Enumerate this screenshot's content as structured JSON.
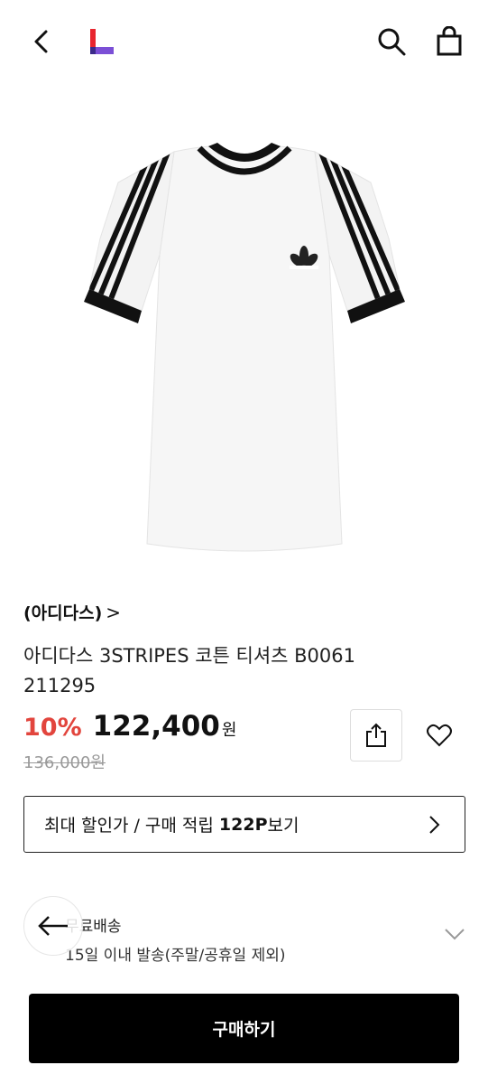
{
  "header": {
    "back_icon": "chevron-left-icon",
    "logo_icon": "lotte-l-logo",
    "search_icon": "search-icon",
    "bag_icon": "shopping-bag-icon"
  },
  "product": {
    "brand": "(아디다스)",
    "brand_chevron": ">",
    "name": "아디다스 3STRIPES 코튼 티셔츠 B0061 211295",
    "discount_rate": "10%",
    "price": "122,400",
    "currency": "원",
    "original_price": "136,000원",
    "image_logo_text": "adidas"
  },
  "actions": {
    "share_icon": "share-icon",
    "wish_icon": "heart-icon"
  },
  "discount_box": {
    "prefix": "최대 할인가 / 구매 적립 ",
    "points": "122P",
    "suffix": "보기"
  },
  "shipping": {
    "title": "무료배송",
    "description": "15일 이내 발송(주말/공휴일 제외)"
  },
  "buy_button": {
    "label": "구매하기"
  },
  "colors": {
    "discount": "#e2453d",
    "logo_red": "#e8262f",
    "logo_purple": "#7b4fd6",
    "button_bg": "#000000"
  }
}
